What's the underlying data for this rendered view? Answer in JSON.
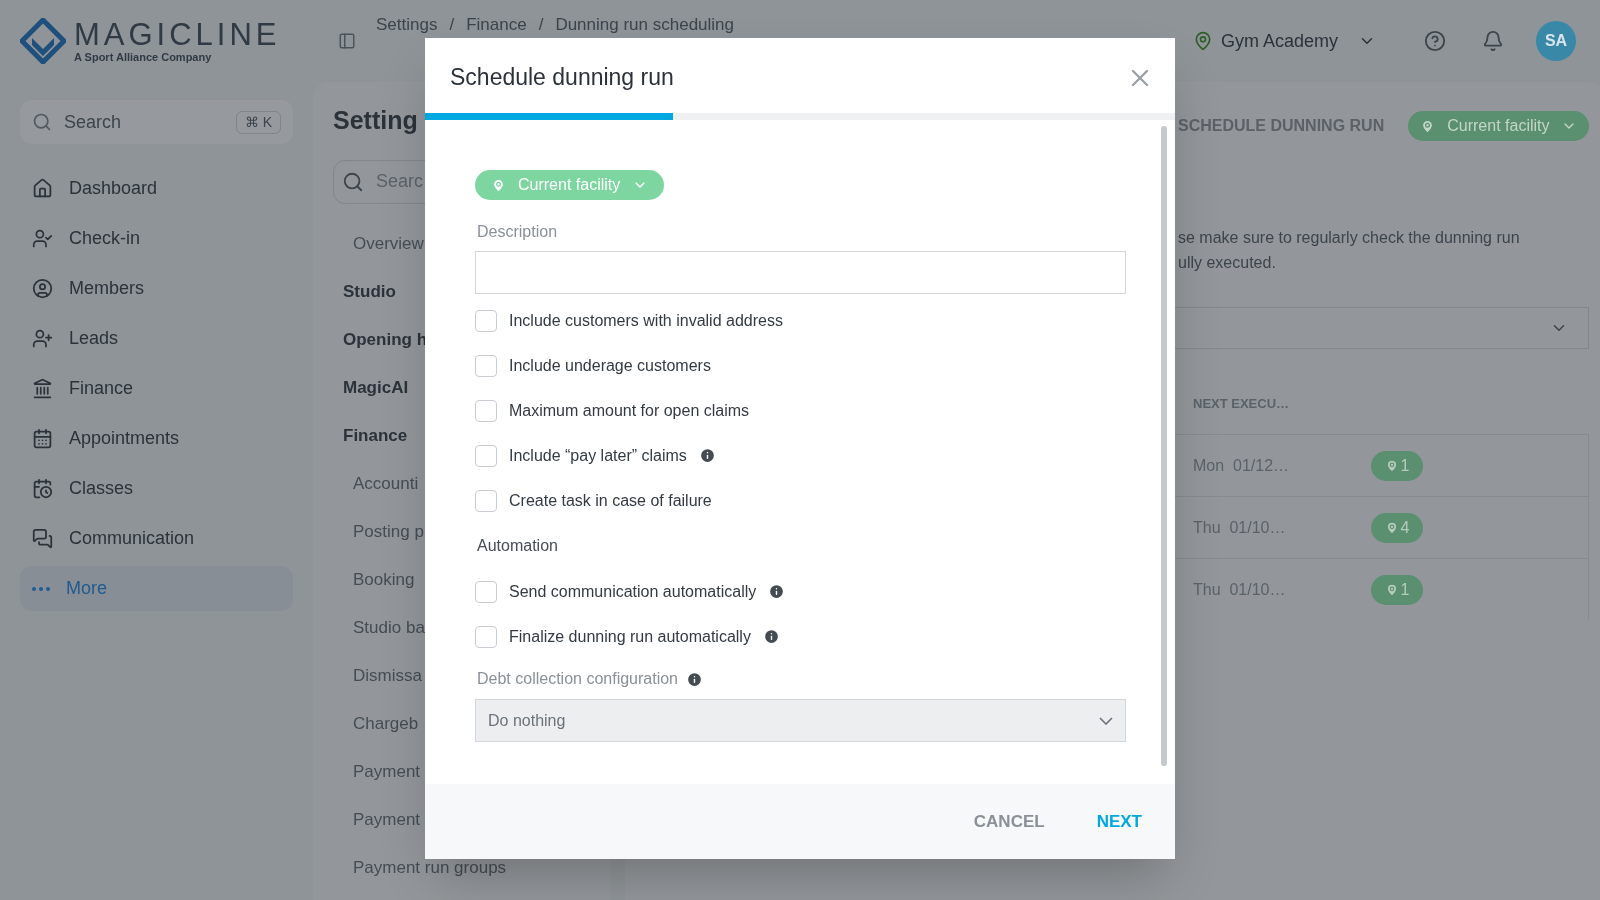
{
  "header": {
    "logo": {
      "name": "MAGICLINE",
      "tagline": "A Sport Alliance Company"
    },
    "breadcrumb": {
      "items": [
        "Settings",
        "Finance",
        "Dunning run scheduling"
      ],
      "separator": "/"
    },
    "facility": "Gym Academy",
    "avatar": "SA"
  },
  "sidebar": {
    "search": {
      "placeholder": "Search",
      "shortcut": "⌘ K"
    },
    "items": [
      {
        "label": "Dashboard",
        "selected": false
      },
      {
        "label": "Check-in",
        "selected": false
      },
      {
        "label": "Members",
        "selected": false
      },
      {
        "label": "Leads",
        "selected": false
      },
      {
        "label": "Finance",
        "selected": false
      },
      {
        "label": "Appointments",
        "selected": false
      },
      {
        "label": "Classes",
        "selected": false
      },
      {
        "label": "Communication",
        "selected": false
      },
      {
        "label": "More",
        "selected": true
      }
    ]
  },
  "settings_nav": {
    "title": "Setting",
    "search_placeholder": "Searc",
    "items": [
      {
        "label": "Overview",
        "kind": "sub"
      },
      {
        "label": "Studio",
        "kind": "group"
      },
      {
        "label": "Opening h",
        "kind": "group"
      },
      {
        "label": "MagicAI",
        "kind": "group"
      },
      {
        "label": "Finance",
        "kind": "group"
      },
      {
        "label": "Accounti",
        "kind": "sub"
      },
      {
        "label": "Posting p",
        "kind": "sub"
      },
      {
        "label": "Booking",
        "kind": "sub"
      },
      {
        "label": "Studio ba",
        "kind": "sub"
      },
      {
        "label": "Dismissa",
        "kind": "sub"
      },
      {
        "label": "Chargeb",
        "kind": "sub"
      },
      {
        "label": "Payment",
        "kind": "sub"
      },
      {
        "label": "Payment",
        "kind": "sub"
      },
      {
        "label": "Payment run groups",
        "kind": "sub"
      }
    ]
  },
  "main": {
    "action": "SCHEDULE DUNNING RUN",
    "facility_filter": "Current facility",
    "notice": [
      "se make sure to regularly check the dunning run",
      "ully executed."
    ],
    "table": {
      "columns": [
        "NEXT EXECU…"
      ],
      "rows": [
        {
          "next_execution": "Mon  01/12…",
          "facilities": "1"
        },
        {
          "next_execution": "Thu  01/10…",
          "facilities": "4"
        },
        {
          "next_execution": "Thu  01/10…",
          "facilities": "1"
        }
      ]
    }
  },
  "modal": {
    "title": "Schedule dunning run",
    "progress": {
      "level": 0.33
    },
    "facility": "Current facility",
    "description": {
      "label": "Description"
    },
    "options": [
      {
        "label": "Include customers with invalid address",
        "checked": false,
        "info": false
      },
      {
        "label": "Include underage customers",
        "checked": false,
        "info": false
      },
      {
        "label": "Maximum amount for open claims",
        "checked": false,
        "info": false
      },
      {
        "label": "Include “pay later” claims",
        "checked": false,
        "info": true
      },
      {
        "label": "Create task in case of failure",
        "checked": false,
        "info": false
      }
    ],
    "automation": {
      "heading": "Automation",
      "options": [
        {
          "label": "Send communication automatically",
          "checked": false,
          "info": true
        },
        {
          "label": "Finalize dunning run automatically",
          "checked": false,
          "info": true
        }
      ]
    },
    "debt_collection": {
      "label": "Debt collection configuration",
      "value": "Do nothing",
      "disabled": true
    },
    "buttons": {
      "cancel": "CANCEL",
      "next": "NEXT"
    }
  }
}
